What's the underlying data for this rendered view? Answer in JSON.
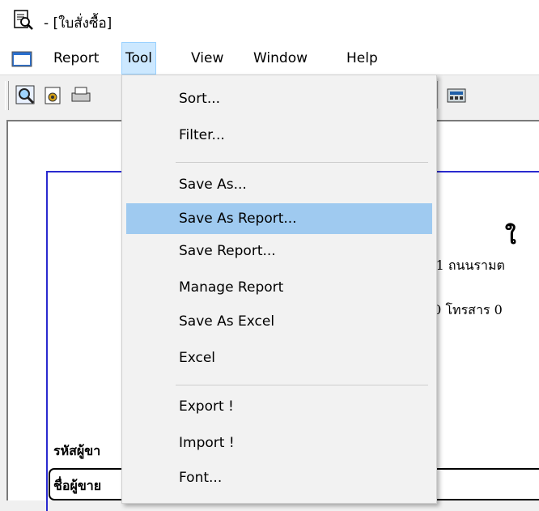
{
  "window": {
    "title": "- [ใบสั่งซื้อ]"
  },
  "menubar": [
    {
      "label": "Report",
      "active": false
    },
    {
      "label": "Tool",
      "active": true
    },
    {
      "label": "View",
      "active": false
    },
    {
      "label": "Window",
      "active": false
    },
    {
      "label": "Help",
      "active": false
    }
  ],
  "toolbar": {
    "icons": [
      "magnifier-icon",
      "open-report-icon",
      "print-icon",
      "grid-icon",
      "resize-icon",
      "calculator-icon"
    ]
  },
  "tool_menu": {
    "items": [
      {
        "label": "Sort...",
        "highlighted": false
      },
      {
        "label": "Filter...",
        "highlighted": false
      },
      {
        "label": "Save As...",
        "highlighted": false
      },
      {
        "label": "Save As Report...",
        "highlighted": true
      },
      {
        "label": "Save Report...",
        "highlighted": false
      },
      {
        "label": "Manage Report",
        "highlighted": false
      },
      {
        "label": "Save As Excel",
        "highlighted": false
      },
      {
        "label": "Excel",
        "highlighted": false
      },
      {
        "label": "Export !",
        "highlighted": false
      },
      {
        "label": "Import !",
        "highlighted": false
      },
      {
        "label": "Font...",
        "highlighted": false
      }
    ]
  },
  "report_preview": {
    "heading_fragment": "ใ",
    "address_fragment": "1/1 ถนนรามต",
    "phone_fragment": "00  โทรสาร 0",
    "vendor_code_label": "รหัสผู้ขา",
    "vendor_name_label": "ชื่อผู้ขาย"
  },
  "colors": {
    "menu_highlight": "#9fcaf0",
    "menubar_active": "#cce8ff",
    "page_border": "#2a2acf"
  }
}
